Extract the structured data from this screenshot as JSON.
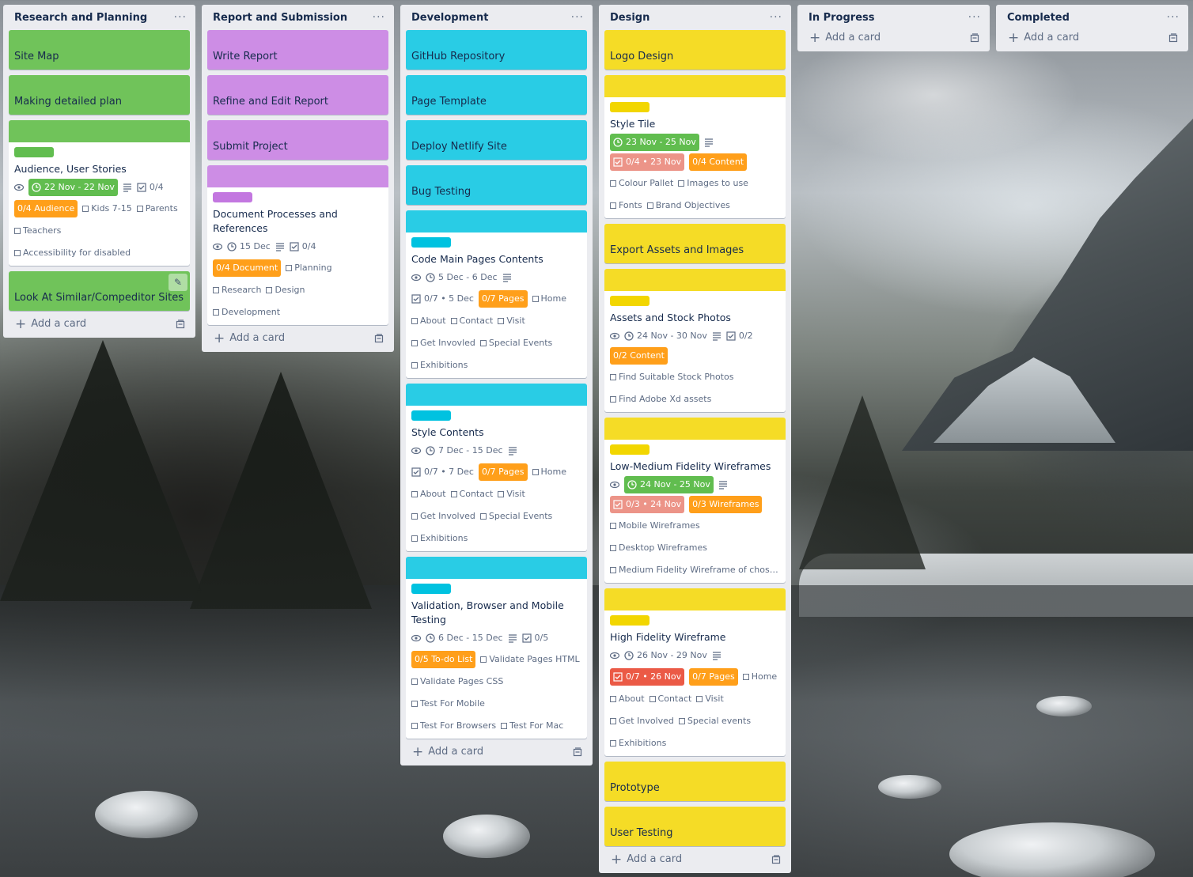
{
  "colors": {
    "green": "#61bd4f",
    "purple": "#c98ee0",
    "cyan": "#29cce5",
    "yellow": "#f5dc26",
    "orange": "#ff9f1a",
    "red_light": "#ec9488",
    "red": "#eb5a46"
  },
  "add_card_label": "Add a card",
  "lists": {
    "research": {
      "title": "Research and Planning",
      "site_map": "Site Map",
      "detailed_plan": "Making detailed plan",
      "audience": {
        "title": "Audience, User Stories",
        "date": "22 Nov - 22 Nov",
        "checklist": "0/4",
        "tag": "0/4 Audience",
        "items": [
          "Kids 7-15",
          "Parents",
          "Teachers",
          "Accessibility for disabled"
        ]
      },
      "similar_sites": "Look At Similar/Compeditor Sites"
    },
    "report": {
      "title": "Report and Submission",
      "write_report": "Write Report",
      "refine_report": "Refine and Edit Report",
      "submit_project": "Submit Project",
      "documents": {
        "title": "Document Processes and References",
        "date": "15 Dec",
        "checklist": "0/4",
        "tag": "0/4 Document",
        "items": [
          "Planning",
          "Research",
          "Design",
          "Development"
        ]
      }
    },
    "development": {
      "title": "Development",
      "github": "GitHub Repository",
      "page_template": "Page Template",
      "deploy": "Deploy Netlify Site",
      "bug_testing": "Bug Testing",
      "code_main": {
        "title": "Code Main Pages Contents",
        "date": "5 Dec - 6 Dec",
        "checklist": "0/7 • 5 Dec",
        "tag": "0/7 Pages",
        "items": [
          "Home",
          "About",
          "Contact",
          "Visit",
          "Get Invovled",
          "Special Events",
          "Exhibitions"
        ]
      },
      "style_contents": {
        "title": "Style Contents",
        "date": "7 Dec - 15 Dec",
        "checklist": "0/7 • 7 Dec",
        "tag": "0/7 Pages",
        "items": [
          "Home",
          "About",
          "Contact",
          "Visit",
          "Get Involved",
          "Special Events",
          "Exhibitions"
        ]
      },
      "validation": {
        "title": "Validation, Browser and Mobile Testing",
        "date": "6 Dec - 15 Dec",
        "checklist": "0/5",
        "tag": "0/5 To-do List",
        "items": [
          "Validate Pages HTML",
          "Validate Pages CSS",
          "Test For Mobile",
          "Test For Browsers",
          "Test For Mac"
        ]
      }
    },
    "design": {
      "title": "Design",
      "logo": "Logo Design",
      "style_tile": {
        "title": "Style Tile",
        "date": "23 Nov - 25 Nov",
        "checklist": "0/4 • 23 Nov",
        "tag": "0/4 Content",
        "items": [
          "Colour Pallet",
          "Images to use",
          "Fonts",
          "Brand Objectives"
        ]
      },
      "export_assets": "Export Assets and Images",
      "assets_photos": {
        "title": "Assets and Stock Photos",
        "date": "24 Nov - 30 Nov",
        "checklist": "0/2",
        "tag": "0/2 Content",
        "items": [
          "Find Suitable Stock Photos",
          "Find Adobe Xd assets"
        ]
      },
      "wireframes": {
        "title": "Low-Medium Fidelity Wireframes",
        "date": "24 Nov - 25 Nov",
        "checklist": "0/3 • 24 Nov",
        "tag": "0/3 Wireframes",
        "items": [
          "Mobile Wireframes",
          "Desktop Wireframes",
          "Medium Fidelity Wireframe of chose…"
        ]
      },
      "high_fidelity": {
        "title": "High Fidelity Wireframe",
        "date": "26 Nov - 29 Nov",
        "checklist": "0/7 • 26 Nov",
        "tag": "0/7 Pages",
        "items": [
          "Home",
          "About",
          "Contact",
          "Visit",
          "Get Involved",
          "Special events",
          "Exhibitions"
        ]
      },
      "prototype": "Prototype",
      "user_testing": "User Testing"
    },
    "in_progress": {
      "title": "In Progress"
    },
    "completed": {
      "title": "Completed"
    }
  }
}
